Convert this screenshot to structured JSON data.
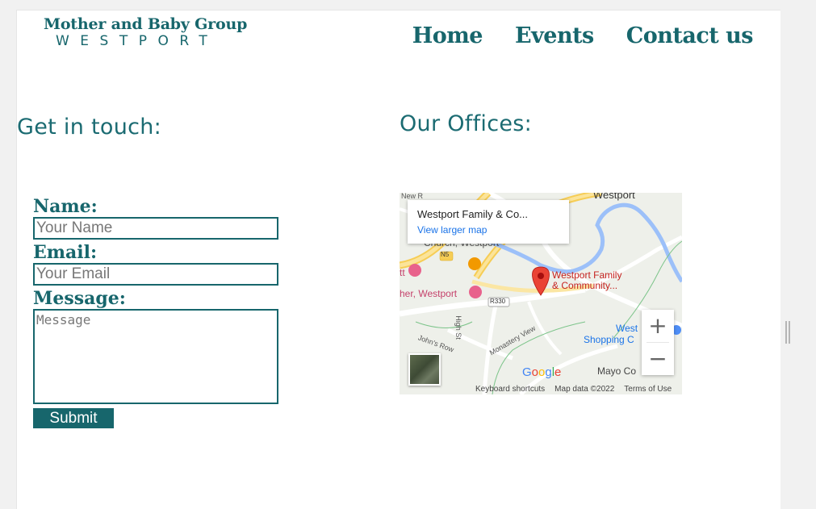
{
  "logo": {
    "line1": "Mother and Baby Group",
    "line2": "WESTPORT"
  },
  "nav": {
    "home": "Home",
    "events": "Events",
    "contact": "Contact us"
  },
  "contact": {
    "heading": "Get in touch:",
    "name_label": "Name:",
    "name_placeholder": "Your Name",
    "email_label": "Email:",
    "email_placeholder": "Your Email",
    "message_label": "Message:",
    "message_placeholder": "Message",
    "submit_label": "Submit"
  },
  "offices": {
    "heading": "Our Offices:",
    "map": {
      "place_name": "Westport Family & Co...",
      "view_larger": "View larger map",
      "marker_label_1": "Westport Family",
      "marker_label_2": "& Community...",
      "labels": {
        "westport_top": "Westport",
        "church": "Church, Westport",
        "other_westport": "her, Westport",
        "tt": "tt",
        "n5": "N5",
        "r330": "R330",
        "high_st": "High St",
        "johns_row": "John's Row",
        "monastery_view": "Monastery View",
        "shopping_1": "West",
        "shopping_2": "Shopping C",
        "mayo": "Mayo Co",
        "new_road": "New R"
      },
      "zoom_in": "+",
      "zoom_out": "−",
      "google": "Google",
      "keyboard_shortcuts": "Keyboard shortcuts",
      "map_data": "Map data ©2022",
      "terms": "Terms of Use"
    }
  },
  "colors": {
    "brand": "#17666c",
    "link": "#1a73e8",
    "marker": "#ea4335"
  }
}
